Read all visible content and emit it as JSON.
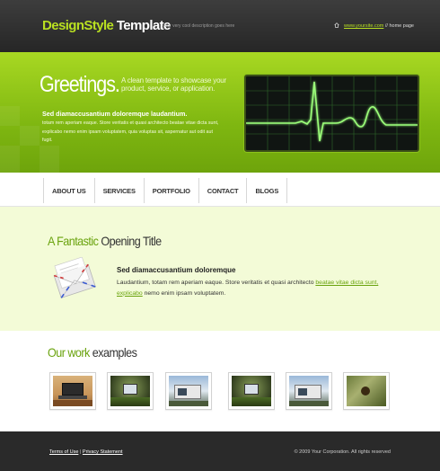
{
  "header": {
    "logo_part1": "DesignStyle",
    "logo_part2": "Template",
    "tagline": "your very cool description goes here",
    "site_link": "www.yoursite.com",
    "separator": "//",
    "home_label": "home page"
  },
  "banner": {
    "greeting": "Greetings.",
    "sub": "A clean template to showcase your product, service, or application.",
    "heading": "Sed diamaccusantium doloremque laudantium.",
    "text": "totam rem aperiam eaque. Store veritatis et quasi architecto beatae vitae dicta sunt, explicabo nemo enim ipsam voluptatem, quia voluptas sit, aspernatur aut odit aut fugit."
  },
  "nav": {
    "items": [
      {
        "label": "ABOUT US"
      },
      {
        "label": "SERVICES"
      },
      {
        "label": "PORTFOLIO"
      },
      {
        "label": "CONTACT"
      },
      {
        "label": "BLOGS"
      }
    ]
  },
  "intro": {
    "title_accent": "A Fantastic",
    "title_rest": "Opening Title",
    "heading": "Sed diamaccusantium doloremque",
    "text_before": "Laudantium, totam rem aperiam eaque. Store veritatis et quasi architecto ",
    "link_text": "beatae vitae dicta sunt, explicabo",
    "text_after": " nemo enim ipsam voluptatem."
  },
  "work": {
    "title_accent": "Our work",
    "title_rest": "examples",
    "thumbnails": [
      {
        "name": "laptop-desk"
      },
      {
        "name": "grass-monitor"
      },
      {
        "name": "modern-house"
      },
      {
        "name": "grass-monitor-2"
      },
      {
        "name": "modern-house-2"
      },
      {
        "name": "grass-field"
      }
    ]
  },
  "footer": {
    "terms": "Terms of Use",
    "divider": "|",
    "privacy": "Privacy Statement",
    "copyright": "© 2009 Your Corporation. All rights reserved"
  },
  "colors": {
    "accent_green": "#6aa30e",
    "logo_green": "#b9e021",
    "banner_green": "#8cc41a",
    "intro_bg": "#f3fbd7",
    "header_bg": "#2e2e2e",
    "footer_bg": "#2a2a2a"
  }
}
